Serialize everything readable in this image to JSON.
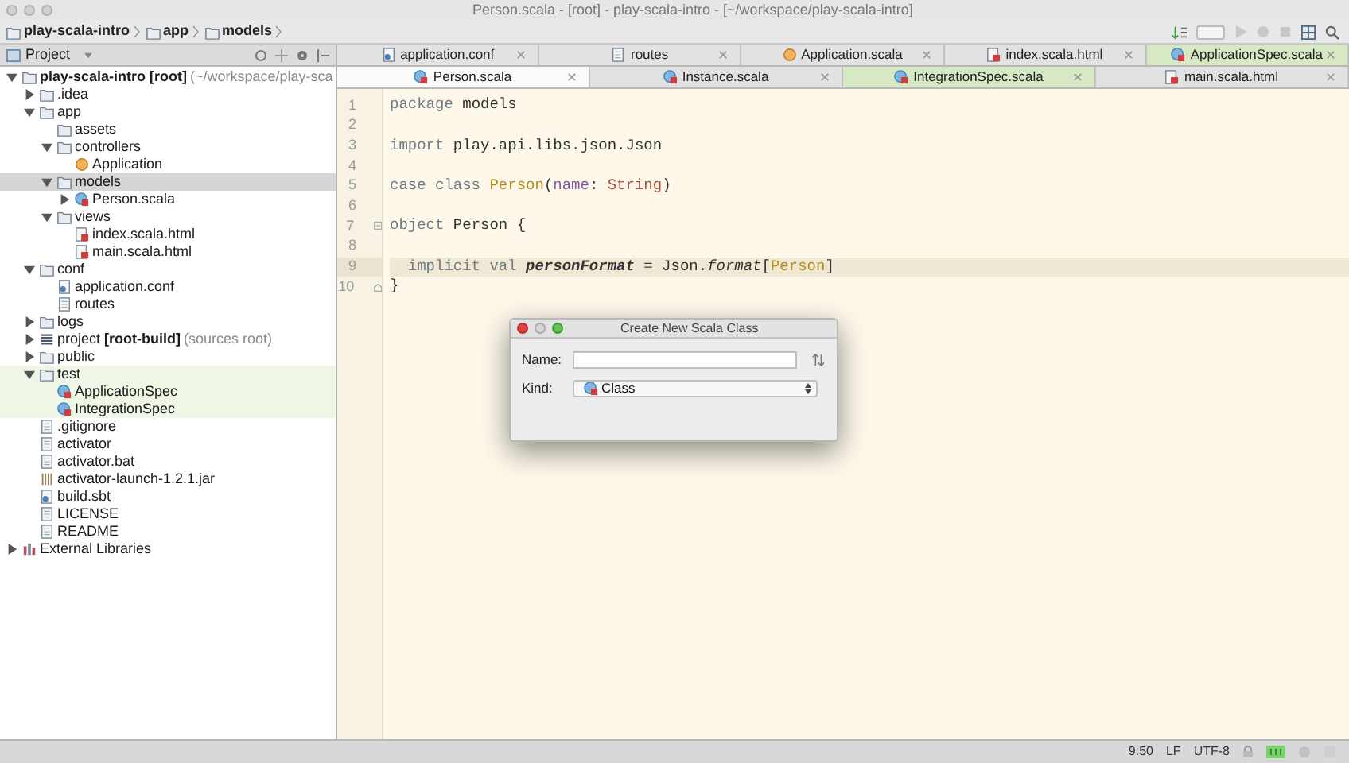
{
  "window": {
    "title": "Person.scala - [root] - play-scala-intro - [~/workspace/play-scala-intro]"
  },
  "breadcrumbs": [
    "play-scala-intro",
    "app",
    "models"
  ],
  "project_panel": {
    "title": "Project"
  },
  "tree": [
    {
      "label": "play-scala-intro [root]",
      "bold": true,
      "note": "(~/workspace/play-sca",
      "kind": "folder",
      "expanded": true,
      "selected": false,
      "tinted": false,
      "children": [
        {
          "label": ".idea",
          "kind": "folder",
          "expanded": false,
          "selected": false,
          "tinted": false
        },
        {
          "label": "app",
          "kind": "folder",
          "expanded": true,
          "selected": false,
          "tinted": false,
          "children": [
            {
              "label": "assets",
              "kind": "folder",
              "selected": false,
              "tinted": false
            },
            {
              "label": "controllers",
              "kind": "folder",
              "expanded": true,
              "selected": false,
              "tinted": false,
              "children": [
                {
                  "label": "Application",
                  "kind": "object",
                  "selected": false,
                  "tinted": false
                }
              ]
            },
            {
              "label": "models",
              "kind": "folder",
              "expanded": true,
              "selected": true,
              "tinted": false,
              "children": [
                {
                  "label": "Person.scala",
                  "kind": "class",
                  "expanded": false,
                  "selected": false,
                  "tinted": false
                }
              ]
            },
            {
              "label": "views",
              "kind": "folder",
              "expanded": true,
              "selected": false,
              "tinted": false,
              "children": [
                {
                  "label": "index.scala.html",
                  "kind": "html",
                  "selected": false,
                  "tinted": false
                },
                {
                  "label": "main.scala.html",
                  "kind": "html",
                  "selected": false,
                  "tinted": false
                }
              ]
            }
          ]
        },
        {
          "label": "conf",
          "kind": "folder",
          "expanded": true,
          "selected": false,
          "tinted": false,
          "children": [
            {
              "label": "application.conf",
              "kind": "conf",
              "selected": false,
              "tinted": false
            },
            {
              "label": "routes",
              "kind": "text",
              "selected": false,
              "tinted": false
            }
          ]
        },
        {
          "label": "logs",
          "kind": "folder",
          "expanded": false,
          "selected": false,
          "tinted": false
        },
        {
          "label": "project **[root-build]**",
          "note": "(sources root)",
          "kind": "module",
          "expanded": false,
          "selected": false,
          "tinted": false
        },
        {
          "label": "public",
          "kind": "folder",
          "expanded": false,
          "selected": false,
          "tinted": false
        },
        {
          "label": "test",
          "kind": "folder",
          "expanded": true,
          "selected": false,
          "tinted": true,
          "children": [
            {
              "label": "ApplicationSpec",
              "kind": "class",
              "selected": false,
              "tinted": true
            },
            {
              "label": "IntegrationSpec",
              "kind": "class",
              "selected": false,
              "tinted": true
            }
          ]
        },
        {
          "label": ".gitignore",
          "kind": "text",
          "selected": false,
          "tinted": false
        },
        {
          "label": "activator",
          "kind": "text",
          "selected": false,
          "tinted": false
        },
        {
          "label": "activator.bat",
          "kind": "text",
          "selected": false,
          "tinted": false
        },
        {
          "label": "activator-launch-1.2.1.jar",
          "kind": "jar",
          "selected": false,
          "tinted": false
        },
        {
          "label": "build.sbt",
          "kind": "conf",
          "selected": false,
          "tinted": false
        },
        {
          "label": "LICENSE",
          "kind": "text",
          "selected": false,
          "tinted": false
        },
        {
          "label": "README",
          "kind": "text",
          "selected": false,
          "tinted": false
        }
      ]
    },
    {
      "label": "External Libraries",
      "kind": "library",
      "expanded": false,
      "selected": false,
      "tinted": false
    }
  ],
  "tab_rows": [
    [
      {
        "label": "application.conf",
        "kind": "conf",
        "selected": false,
        "tinted": false
      },
      {
        "label": "routes",
        "kind": "text",
        "selected": false,
        "tinted": false
      },
      {
        "label": "Application.scala",
        "kind": "object",
        "selected": false,
        "tinted": false
      },
      {
        "label": "index.scala.html",
        "kind": "html",
        "selected": false,
        "tinted": false
      },
      {
        "label": "ApplicationSpec.scala",
        "kind": "class",
        "selected": false,
        "tinted": true
      }
    ],
    [
      {
        "label": "Person.scala",
        "kind": "class",
        "selected": true,
        "tinted": false
      },
      {
        "label": "Instance.scala",
        "kind": "class",
        "selected": false,
        "tinted": false
      },
      {
        "label": "IntegrationSpec.scala",
        "kind": "class",
        "selected": false,
        "tinted": true
      },
      {
        "label": "main.scala.html",
        "kind": "html",
        "selected": false,
        "tinted": false
      }
    ]
  ],
  "code_lines": [
    {
      "number": "1",
      "current": false,
      "kind": "plain",
      "tokens": [
        {
          "kind": "keyword",
          "text": "package"
        },
        {
          "kind": "plain",
          "text": " models"
        }
      ]
    },
    {
      "number": "2",
      "current": false,
      "kind": "plain"
    },
    {
      "number": "3",
      "current": false,
      "kind": "plain",
      "tokens": [
        {
          "kind": "keyword",
          "text": "import"
        },
        {
          "kind": "plain",
          "text": " play.api.libs.json.Json"
        }
      ]
    },
    {
      "number": "4",
      "current": false,
      "kind": "plain"
    },
    {
      "number": "5",
      "current": false,
      "kind": "plain",
      "tokens": [
        {
          "kind": "keyword",
          "text": "case class "
        },
        {
          "kind": "type",
          "text": "Person"
        },
        {
          "kind": "plain",
          "text": "("
        },
        {
          "kind": "param",
          "text": "name"
        },
        {
          "kind": "plain",
          "text": ": "
        },
        {
          "kind": "builtin",
          "text": "String"
        },
        {
          "kind": "plain",
          "text": ")"
        }
      ]
    },
    {
      "number": "6",
      "current": false,
      "kind": "plain"
    },
    {
      "number": "7",
      "current": false,
      "kind": "fold_start",
      "tokens": [
        {
          "kind": "keyword",
          "text": "object"
        },
        {
          "kind": "plain",
          "text": " Person {"
        }
      ]
    },
    {
      "number": "8",
      "current": false,
      "kind": "plain"
    },
    {
      "number": "9",
      "current": true,
      "kind": "plain",
      "tokens": [
        {
          "kind": "keyword",
          "text": "  implicit val "
        },
        {
          "kind": "definition",
          "text": "personFormat"
        },
        {
          "kind": "plain",
          "text": " = Json."
        },
        {
          "kind": "method",
          "text": "format"
        },
        {
          "kind": "plain",
          "text": "["
        },
        {
          "kind": "type",
          "text": "Person"
        },
        {
          "kind": "plain",
          "text": "]"
        }
      ]
    },
    {
      "number": "10",
      "current": false,
      "kind": "fold_end",
      "tokens": [
        {
          "kind": "plain",
          "text": "}"
        }
      ]
    }
  ],
  "dialog": {
    "title": "Create New Scala Class",
    "name_label": "Name:",
    "kind_label": "Kind:",
    "kind_value": "Class"
  },
  "status_bar": {
    "position": "9:50",
    "line_separator": "LF",
    "encoding": "UTF-8"
  }
}
